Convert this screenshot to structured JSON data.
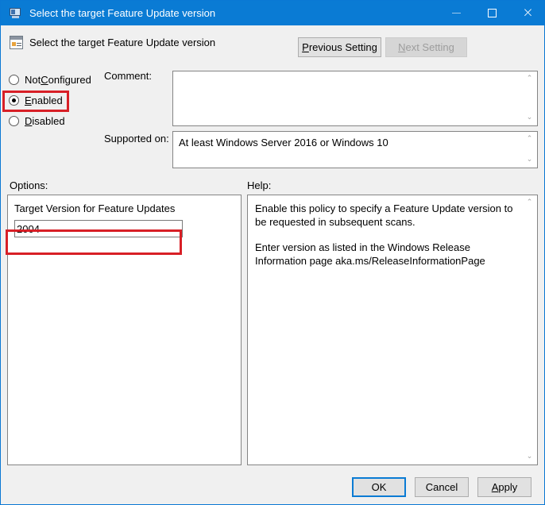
{
  "window": {
    "title": "Select the target Feature Update version",
    "title_icon": "policy-monitor-icon",
    "minimize_label": "",
    "maximize_label": "",
    "close_label": "×",
    "border_color": "#0a78d4",
    "titlebar_color": "#0a7bd4"
  },
  "header": {
    "icon": "policy-setting-icon",
    "title": "Select the target Feature Update version",
    "previous_setting": {
      "label_before": "",
      "accel": "P",
      "label_after": "revious Setting"
    },
    "next_setting": {
      "label_before": "",
      "accel": "N",
      "label_after": "ext Setting",
      "disabled": true
    }
  },
  "state_options": [
    {
      "label_before": "Not ",
      "accel": "C",
      "label_after": "onfigured",
      "selected": false
    },
    {
      "label_before": "",
      "accel": "E",
      "label_after": "nabled",
      "selected": true
    },
    {
      "label_before": "",
      "accel": "D",
      "label_after": "isabled",
      "selected": false
    }
  ],
  "fields": {
    "comment_label": "Comment:",
    "comment_value": "",
    "supported_label": "Supported on:",
    "supported_value": "At least Windows Server 2016 or Windows 10"
  },
  "options": {
    "section_label": "Options:",
    "target_version_label": "Target Version for Feature Updates",
    "target_version_value": "2004",
    "target_version_placeholder": ""
  },
  "help": {
    "section_label": "Help:",
    "paragraphs": [
      "Enable this policy to specify a Feature Update version to be requested in subsequent scans.",
      "Enter version as listed in the Windows Release Information page aka.ms/ReleaseInformationPage"
    ]
  },
  "footer": {
    "ok_label": "OK",
    "cancel_label": "Cancel",
    "apply": {
      "label_before": "",
      "accel": "A",
      "label_after": "pply"
    }
  },
  "annotations": {
    "highlight_color": "#d81f26",
    "highlighted_elements": [
      "enabled-radio",
      "target-version-input"
    ]
  },
  "scroll_arrows": {
    "up": "⌃",
    "down": "⌄"
  }
}
